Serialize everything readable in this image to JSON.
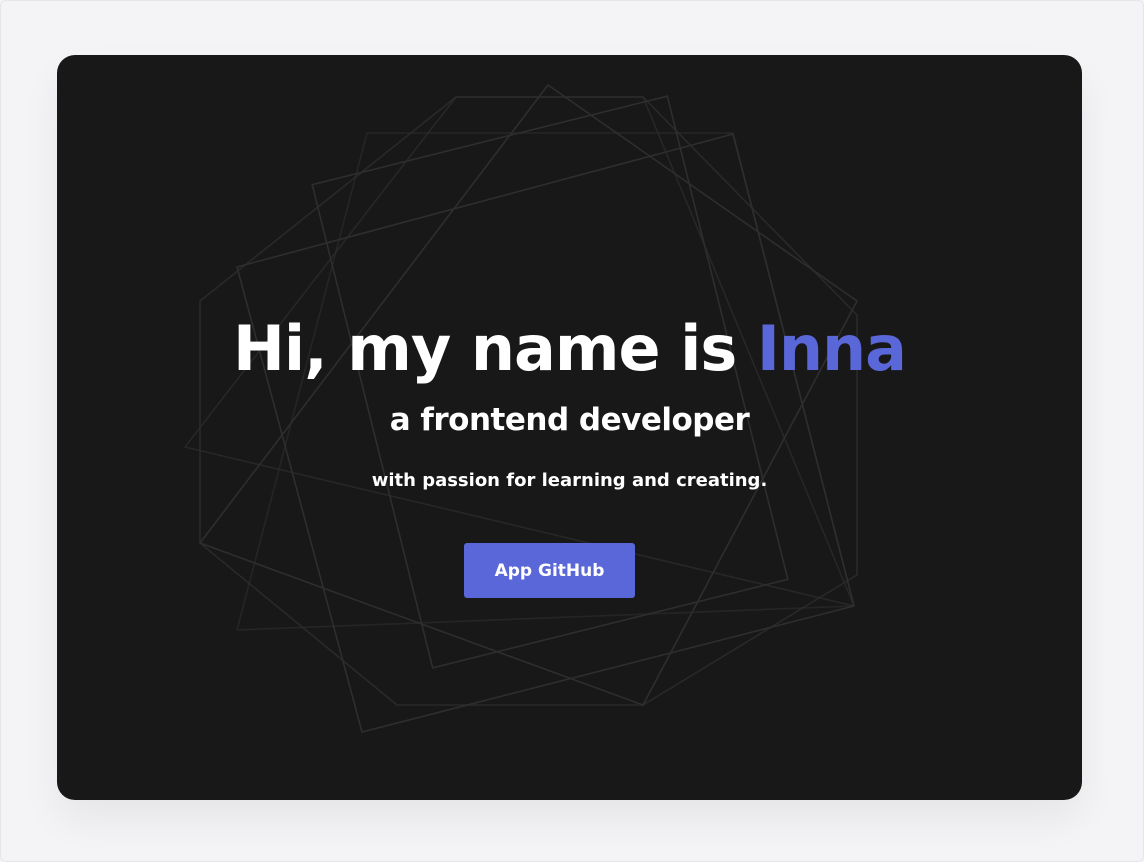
{
  "hero": {
    "greeting": "Hi, my name is ",
    "name": "Inna",
    "role": "a frontend developer",
    "tagline": "with passion for learning and creating.",
    "cta_label": "App GitHub"
  },
  "colors": {
    "page_background": "#f4f4f7",
    "card_background": "#181818",
    "accent": "#5a67d8",
    "text": "#ffffff",
    "decor_lines": "#2e2e2e"
  }
}
